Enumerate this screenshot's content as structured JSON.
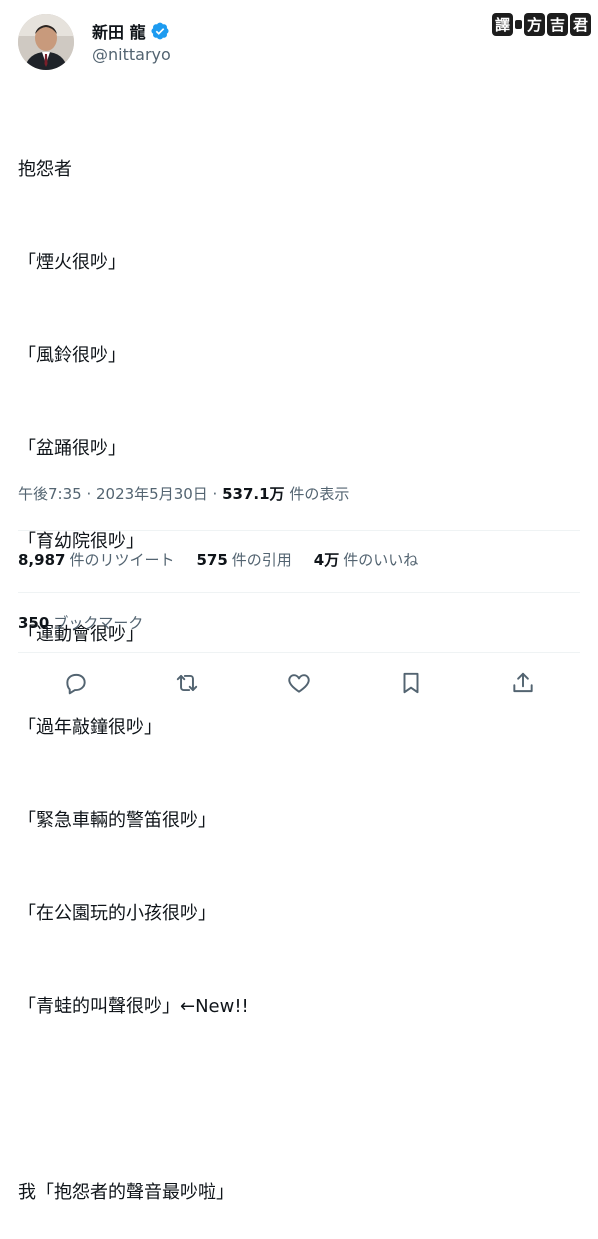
{
  "author": {
    "display_name": "新田 龍",
    "username": "@nittaryo",
    "avatar_icon": "person-avatar",
    "verified_icon": "verified-badge-icon",
    "verified_color": "#1d9bf0"
  },
  "watermark": {
    "chars": [
      "譯",
      "方",
      "吉",
      "君"
    ]
  },
  "tweet": {
    "lines": [
      "抱怨者",
      "「煙火很吵」",
      "「風鈴很吵」",
      "「盆踊很吵」",
      "「育幼院很吵」",
      "「運動會很吵」",
      "「過年敲鐘很吵」",
      "「緊急車輛的警笛很吵」",
      "「在公園玩的小孩很吵」",
      "「青蛙的叫聲很吵」←New!!",
      "",
      "我「抱怨者的聲音最吵啦」"
    ]
  },
  "meta": {
    "timestamp": "午後7:35 · 2023年5月30日 · ",
    "views_count": "537.1万",
    "views_label": " 件の表示"
  },
  "stats": {
    "retweets_count": "8,987",
    "retweets_label": "件のリツイート",
    "quotes_count": "575",
    "quotes_label": "件の引用",
    "likes_count": "4万",
    "likes_label": "件のいいね"
  },
  "bookmarks": {
    "count": "350",
    "label": "ブックマーク"
  },
  "actions": [
    "reply-icon",
    "retweet-icon",
    "like-icon",
    "bookmark-icon",
    "share-icon"
  ]
}
